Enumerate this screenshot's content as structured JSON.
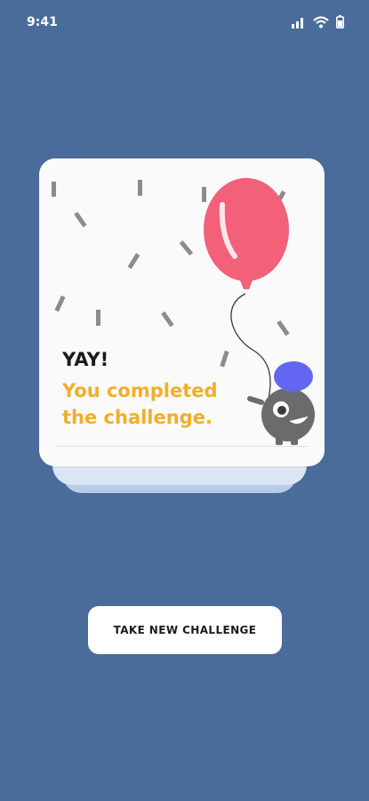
{
  "status_bar": {
    "time": "9:41",
    "icons": [
      "signal-icon",
      "wifi-icon",
      "battery-icon"
    ]
  },
  "card": {
    "title": "YAY!",
    "message": "You completed the challenge.",
    "illustration": "balloon-monster",
    "colors": {
      "balloon": "#f2607a",
      "monster": "#6b6b6b",
      "hat": "#6366f1",
      "message": "#f2ae2a"
    }
  },
  "cta": {
    "label": "TAKE NEW CHALLENGE"
  },
  "colors": {
    "background": "#4a6c9b",
    "card": "#fafafa"
  }
}
